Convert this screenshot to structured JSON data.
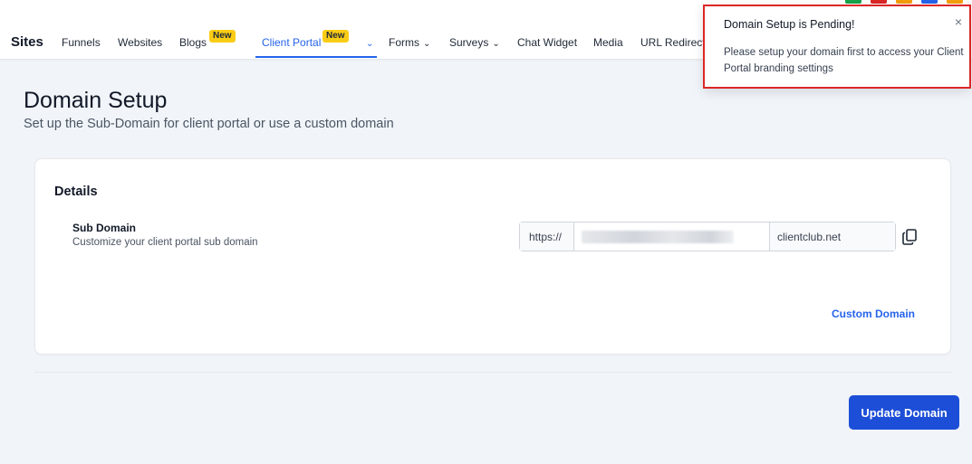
{
  "nav": {
    "title": "Sites",
    "items": [
      {
        "label": "Funnels"
      },
      {
        "label": "Websites"
      },
      {
        "label": "Blogs",
        "badge": "New"
      },
      {
        "label": "Client Portal",
        "badge": "New"
      },
      {
        "label": "Forms"
      },
      {
        "label": "Surveys"
      },
      {
        "label": "Chat Widget"
      },
      {
        "label": "Media"
      },
      {
        "label": "URL Redirects"
      }
    ],
    "active_color": "#2563eb"
  },
  "page": {
    "title": "Domain Setup",
    "subtitle": "Set up the Sub-Domain for client portal or use a custom domain"
  },
  "card": {
    "title": "Details",
    "sub_domain": {
      "label": "Sub Domain",
      "help": "Customize your client portal sub domain",
      "prefix": "https://",
      "value": "",
      "suffix": "clientclub.net"
    },
    "custom_domain_link": "Custom Domain"
  },
  "actions": {
    "update_label": "Update Domain"
  },
  "toast": {
    "title": "Domain Setup is Pending!",
    "body": "Please setup your domain first to access your Client Portal branding settings",
    "close": "×",
    "border_color": "#dc2626"
  }
}
